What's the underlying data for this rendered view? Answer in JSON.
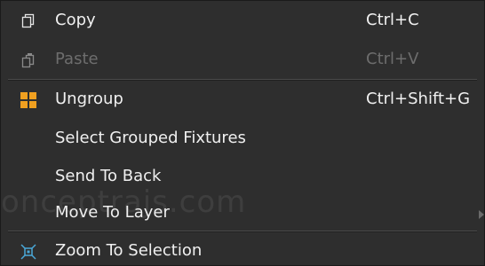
{
  "menu": {
    "items": [
      {
        "icon": "copy-icon",
        "label": "Copy",
        "shortcut": "Ctrl+C",
        "enabled": true
      },
      {
        "icon": "paste-icon",
        "label": "Paste",
        "shortcut": "Ctrl+V",
        "enabled": false
      },
      {
        "icon": "ungroup-icon",
        "label": "Ungroup",
        "shortcut": "Ctrl+Shift+G",
        "enabled": true
      },
      {
        "icon": "",
        "label": "Select Grouped Fixtures",
        "shortcut": "",
        "enabled": true
      },
      {
        "icon": "",
        "label": "Send To Back",
        "shortcut": "",
        "enabled": true
      },
      {
        "icon": "",
        "label": "Move To Layer",
        "shortcut": "",
        "enabled": true,
        "has_submenu": true
      },
      {
        "icon": "zoom-to-selection-icon",
        "label": "Zoom To Selection",
        "shortcut": "",
        "enabled": true
      }
    ],
    "watermark": "onceptrajs.com"
  },
  "colors": {
    "background": "#2e2e2e",
    "text": "#f0f0f0",
    "disabled_text": "#6d6d6d",
    "ungroup_icon": "#f0a020",
    "zoom_icon": "#4aa8d8"
  }
}
